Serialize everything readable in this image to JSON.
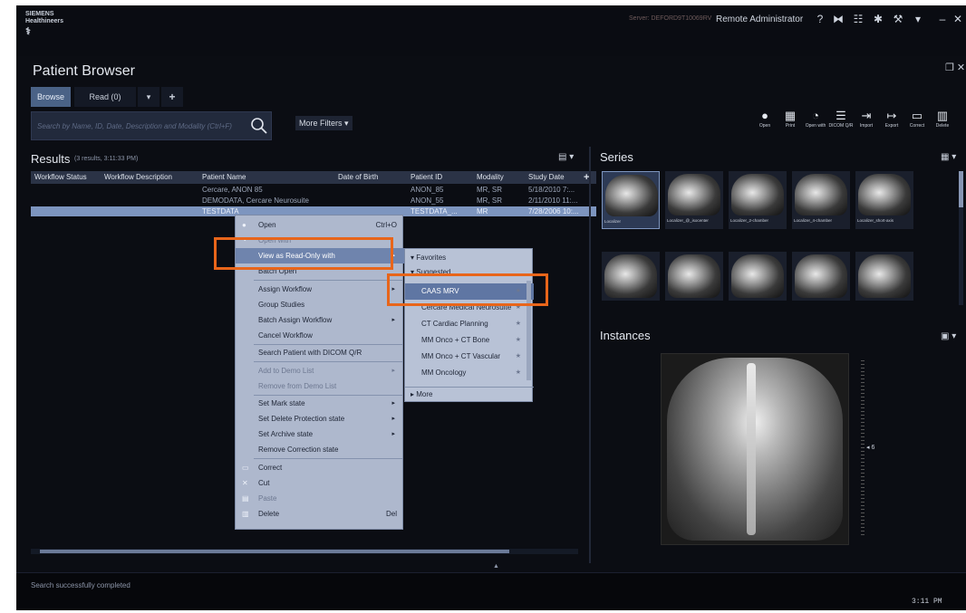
{
  "topbar": {
    "brand_line1": "SIEMENS",
    "brand_line2": "Healthineers",
    "server": "Server: DEFORD9T10069RV",
    "user": "Remote Administrator",
    "icons": [
      "help-icon",
      "screen-layout-icon",
      "network-icon",
      "settings-icon",
      "tools-icon",
      "cart-icon",
      "minimize-icon",
      "close-icon"
    ]
  },
  "page": {
    "title": "Patient Browser"
  },
  "tabs": {
    "browse": "Browse",
    "read": "Read (0)"
  },
  "search": {
    "placeholder": "Search by Name, ID, Date, Description and Modality (Ctrl+F)"
  },
  "more_filters": "More Filters",
  "toolbar": [
    {
      "label": "Open",
      "icon": "play-icon"
    },
    {
      "label": "Print",
      "icon": "print-icon"
    },
    {
      "label": "Open with",
      "icon": "open-with-icon"
    },
    {
      "label": "DICOM Q/R",
      "icon": "dicom-icon"
    },
    {
      "label": "Import",
      "icon": "import-icon"
    },
    {
      "label": "Export",
      "icon": "export-icon"
    },
    {
      "label": "Correct",
      "icon": "correct-icon"
    },
    {
      "label": "Delete",
      "icon": "trash-icon"
    }
  ],
  "results": {
    "title": "Results",
    "meta": "(3 results, 3:11:33 PM)",
    "columns": [
      "Workflow Status",
      "Workflow Description",
      "Patient Name",
      "Date of Birth",
      "Patient ID",
      "Modality",
      "Study Date"
    ],
    "rows": [
      [
        "",
        "",
        "Cercare, ANON 85",
        "",
        "ANON_85",
        "MR, SR",
        "5/18/2010 7:..."
      ],
      [
        "",
        "",
        "DEMODATA, Cercare Neurosuite",
        "",
        "ANON_55",
        "MR, SR",
        "2/11/2010 11:..."
      ],
      [
        "",
        "",
        "TESTDATA",
        "",
        "TESTDATA_...",
        "MR",
        "7/28/2006 10:..."
      ]
    ]
  },
  "context_menu": {
    "items": [
      {
        "label": "Open",
        "shortcut": "Ctrl+O"
      },
      {
        "label": "Open with"
      },
      {
        "label": "View as Read-Only with"
      },
      {
        "label": "Batch Open"
      },
      {
        "label": "Assign Workflow"
      },
      {
        "label": "Group Studies"
      },
      {
        "label": "Batch Assign Workflow"
      },
      {
        "label": "Cancel Workflow"
      },
      {
        "label": "Search Patient with DICOM Q/R"
      },
      {
        "label": "Add to Demo List"
      },
      {
        "label": "Remove from Demo List"
      },
      {
        "label": "Set Mark state"
      },
      {
        "label": "Set Delete Protection state"
      },
      {
        "label": "Set Archive state"
      },
      {
        "label": "Remove Correction state"
      },
      {
        "label": "Correct"
      },
      {
        "label": "Cut"
      },
      {
        "label": "Paste"
      },
      {
        "label": "Delete",
        "shortcut": "Del"
      }
    ]
  },
  "submenu": {
    "favorites": "Favorites",
    "suggested": "Suggested",
    "items": [
      "CAAS MRV",
      "Cercare Medical Neurosuite",
      "CT Cardiac Planning",
      "MM Onco + CT Bone",
      "MM Onco + CT Vascular",
      "MM Oncology"
    ],
    "more": "More"
  },
  "series": {
    "title": "Series",
    "thumbs": [
      "Localizer",
      "Localizer_@_isocenter",
      "Localizer_2-chamber",
      "Localizer_4-chamber",
      "Localizer_short-axis"
    ]
  },
  "instances": {
    "title": "Instances",
    "slice_number": "6"
  },
  "status": {
    "message": "Search successfully completed",
    "clock": "3:11 PM"
  },
  "colors": {
    "accent": "#7d95bf",
    "highlight": "#e8651a",
    "background": "#0b0d13"
  }
}
